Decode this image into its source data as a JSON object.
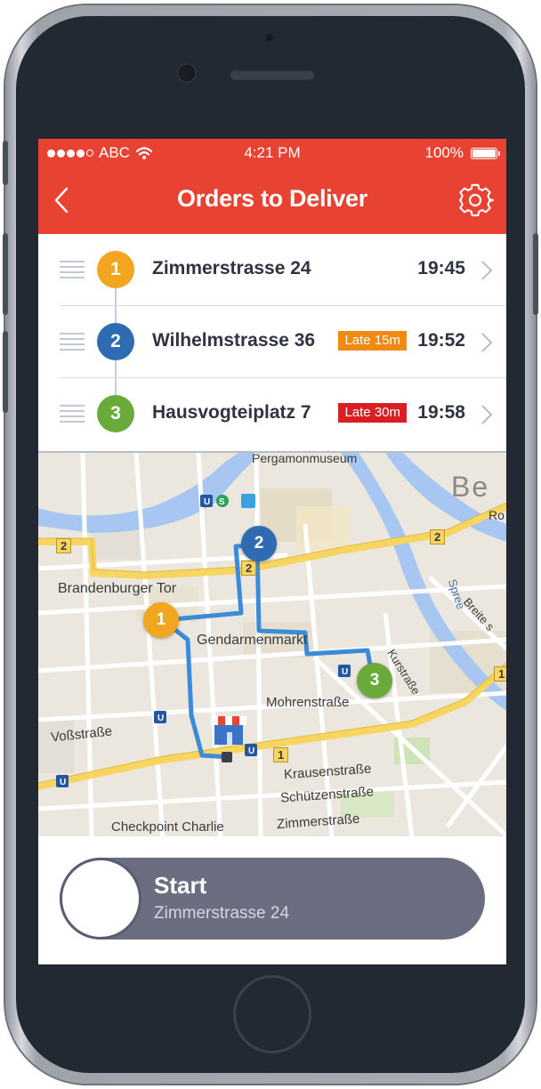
{
  "status_bar": {
    "carrier": "ABC",
    "time": "4:21 PM",
    "battery": "100%"
  },
  "nav": {
    "title": "Orders to Deliver"
  },
  "colors": {
    "brand_red": "#e84233",
    "stop_1": "#f2a51f",
    "stop_2": "#2e6bb0",
    "stop_3": "#6aaa3a",
    "late_orange": "#f08a12",
    "late_red": "#d91f26",
    "route_blue": "#3a8bd8"
  },
  "orders": [
    {
      "number": "1",
      "street": "Zimmerstrasse 24",
      "late": "",
      "time": "19:45"
    },
    {
      "number": "2",
      "street": "Wilhelmstrasse 36",
      "late": "Late 15m",
      "time": "19:52"
    },
    {
      "number": "3",
      "street": "Hausvogteiplatz 7",
      "late": "Late 30m",
      "time": "19:58"
    }
  ],
  "map": {
    "labels": {
      "pergamon": "Pergamonmuseum",
      "berlin": "Be",
      "ro": "Ro",
      "spree": "Spree",
      "brandenburger": "Brandenburger Tor",
      "gendarmenmarkt": "Gendarmenmarkt",
      "breite": "Breite s",
      "kurstrasse": "Kurstraße",
      "mohrenstrasse": "Mohrenstraße",
      "vossstrasse": "Voßstraße",
      "krausenstrasse": "Krausenstraße",
      "schuetzenstrasse": "Schützenstraße",
      "zimmerstrasse": "Zimmerstraße",
      "checkpoint": "Checkpoint Charlie",
      "road_2a": "2",
      "road_2b": "2",
      "road_2c": "2",
      "road_1": "1",
      "road_1b": "1"
    },
    "pins": [
      "1",
      "2",
      "3"
    ]
  },
  "slider": {
    "title": "Start",
    "subtitle": "Zimmerstrasse 24"
  }
}
